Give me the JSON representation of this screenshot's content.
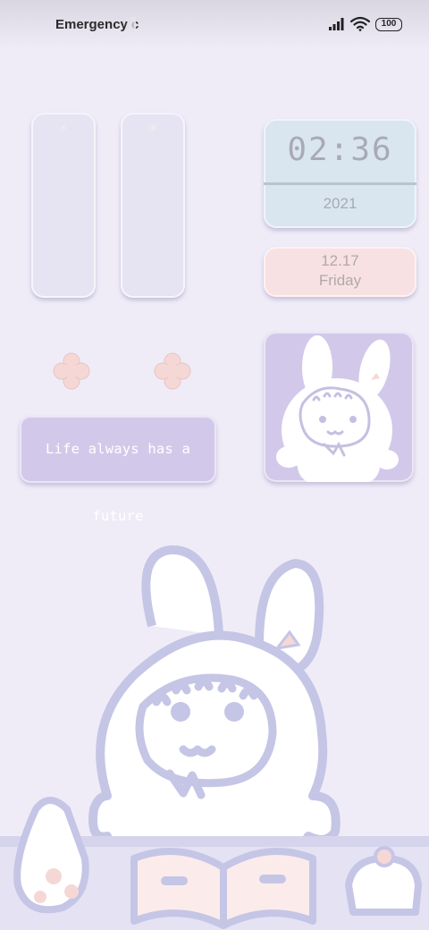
{
  "status_bar": {
    "carrier": "Emergency c",
    "battery_level": "100",
    "icons": [
      "signal-icon",
      "wifi-icon",
      "battery-icon"
    ]
  },
  "widgets": {
    "sliders": [
      {
        "icon": "flash-icon",
        "glyph": "⚡"
      },
      {
        "icon": "brightness-icon",
        "glyph": "☀"
      }
    ],
    "clock": {
      "time": "02:36",
      "year": "2021"
    },
    "date": {
      "day_month": "12.17",
      "weekday": "Friday"
    },
    "quote": "Life always has a future",
    "decorations": [
      "flower-icon",
      "flower-icon"
    ],
    "photo": "bunny-illustration"
  },
  "colors": {
    "background": "#efecf8",
    "slider": "#e6e4f3",
    "clock": "#d9e6f0",
    "date": "#f7e1e2",
    "quote": "#d2c9ea",
    "flower": "#f5d8d6",
    "line_art": "#c5c5e6"
  }
}
